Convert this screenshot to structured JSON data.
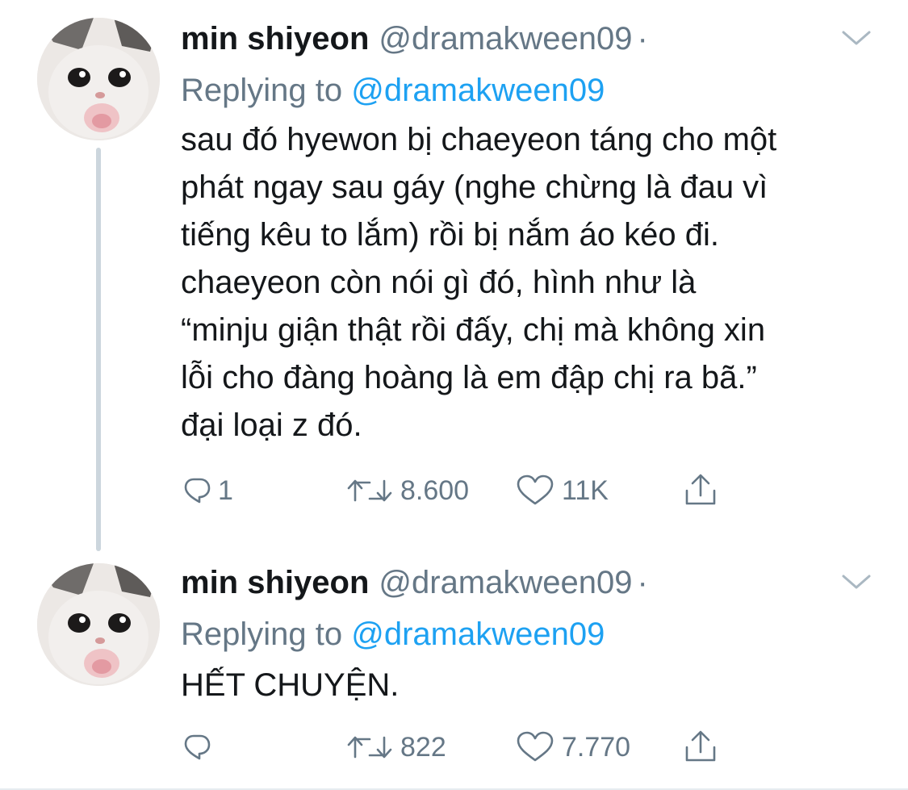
{
  "tweets": [
    {
      "display_name": "min shiyeon",
      "handle": "@dramakween09",
      "separator": "·",
      "replying_prefix": "Replying to",
      "replying_to": "@dramakween09",
      "text": "sau đó hyewon bị chaeyeon táng cho một\nphát ngay sau gáy (nghe chừng là đau vì\ntiếng kêu to lắm) rồi bị nắm áo kéo đi.\nchaeyeon còn nói gì đó, hình như là\n“minju giận thật rồi đấy, chị mà không xin\nlỗi cho đàng hoàng là em đập chị ra bã.”\nđại loại z đó.",
      "reply_count": "1",
      "retweet_count": "8.600",
      "like_count": "11K"
    },
    {
      "display_name": "min shiyeon",
      "handle": "@dramakween09",
      "separator": "·",
      "replying_prefix": "Replying to",
      "replying_to": "@dramakween09",
      "text": "HẾT CHUYỆN.",
      "reply_count": "",
      "retweet_count": "822",
      "like_count": "7.770"
    }
  ],
  "icons": {
    "reply": "reply-icon",
    "retweet": "retweet-icon",
    "like": "heart-icon",
    "share": "share-icon",
    "menu": "chevron-down-icon"
  },
  "colors": {
    "text": "#14171a",
    "secondary": "#657786",
    "link": "#1da1f2",
    "thread_line": "#ccd6dd"
  }
}
